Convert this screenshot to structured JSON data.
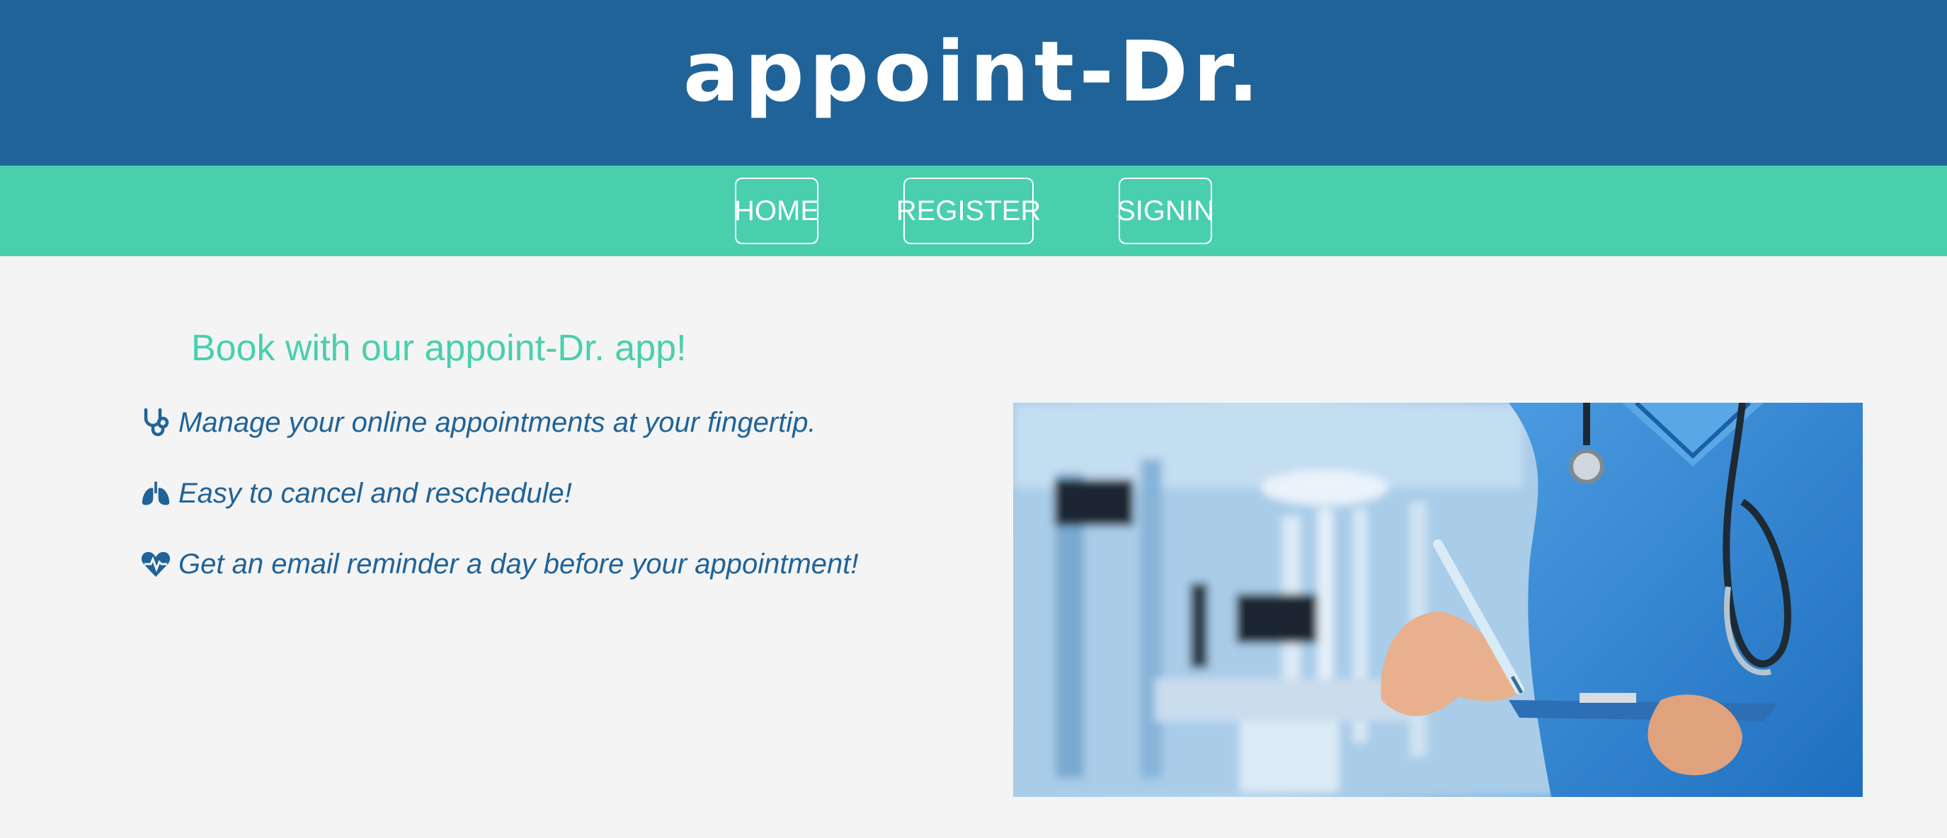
{
  "header": {
    "title": "appoint-Dr."
  },
  "nav": {
    "home": "HOME",
    "register": "REGISTER",
    "signin": "SIGNIN"
  },
  "main": {
    "title": "Book with our appoint-Dr. app!",
    "features": [
      {
        "icon": "stethoscope-icon",
        "text": "Manage your online appointments at your fingertip."
      },
      {
        "icon": "lungs-icon",
        "text": "Easy to cancel and reschedule!"
      },
      {
        "icon": "heart-pulse-icon",
        "text": "Get an email reminder a day before your appointment!"
      }
    ]
  },
  "colors": {
    "header": "#206398",
    "nav": "#49cfae",
    "accent": "#49cfae",
    "text": "#206398",
    "background": "#f4f4f4"
  }
}
